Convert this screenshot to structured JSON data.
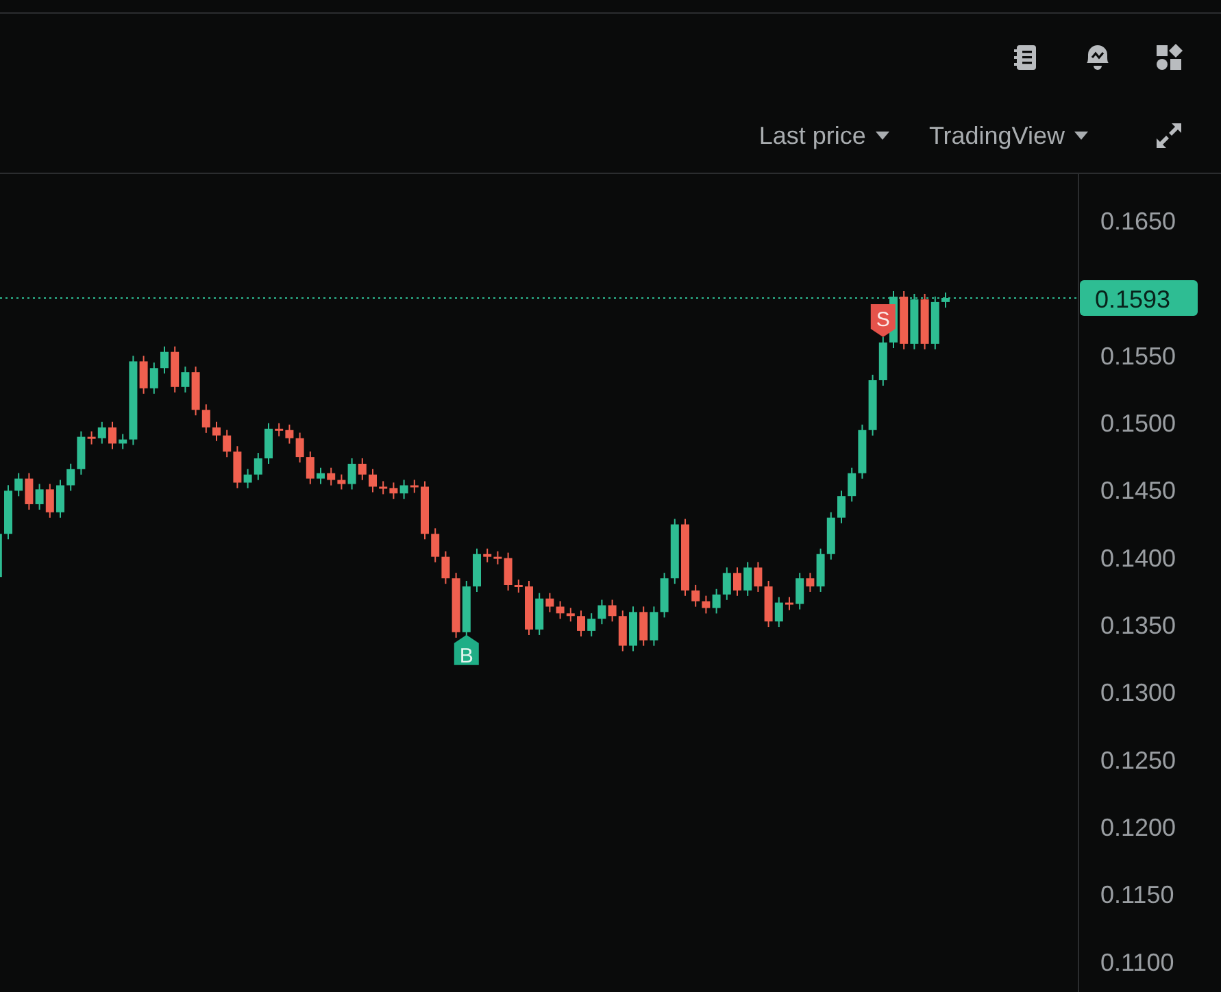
{
  "toolbar": {
    "dropdowns": [
      {
        "label": "Last price"
      },
      {
        "label": "TradingView"
      }
    ]
  },
  "chart": {
    "current_price": "0.1593",
    "price_axis": [
      "0.1650",
      "0.1550",
      "0.1500",
      "0.1450",
      "0.1400",
      "0.1350",
      "0.1300",
      "0.1250",
      "0.1200",
      "0.1150",
      "0.1100"
    ],
    "markers": [
      {
        "kind": "buy",
        "label": "B"
      },
      {
        "kind": "sell",
        "label": "S"
      }
    ]
  }
}
